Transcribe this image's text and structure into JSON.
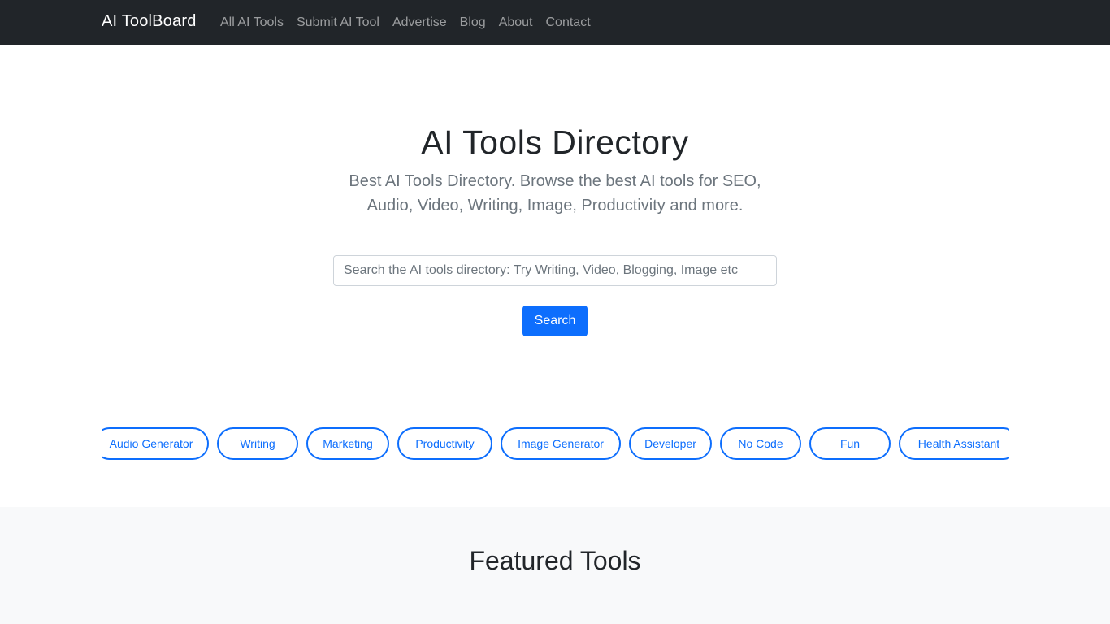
{
  "navbar": {
    "brand": "AI ToolBoard",
    "links": [
      "All AI Tools",
      "Submit AI Tool",
      "Advertise",
      "Blog",
      "About",
      "Contact"
    ]
  },
  "hero": {
    "title": "AI Tools Directory",
    "subtitle": "Best AI Tools Directory. Browse the best AI tools for SEO, Audio, Video, Writing, Image, Productivity and more.",
    "search_placeholder": "Search the AI tools directory: Try Writing, Video, Blogging, Image etc",
    "search_value": "",
    "search_button": "Search"
  },
  "categories": [
    {
      "label": "Audio Generator",
      "width": 142
    },
    {
      "label": "Writing",
      "width": 100
    },
    {
      "label": "Marketing",
      "width": 102
    },
    {
      "label": "Productivity",
      "width": 117
    },
    {
      "label": "Image Generator",
      "width": 148
    },
    {
      "label": "Developer",
      "width": 102
    },
    {
      "label": "No Code",
      "width": 100
    },
    {
      "label": "Fun",
      "width": 100
    },
    {
      "label": "Health Assistant",
      "width": 148
    }
  ],
  "featured": {
    "title": "Featured Tools"
  },
  "colors": {
    "navbar_bg": "#212529",
    "primary": "#0d6efd",
    "muted_text": "#6c757d",
    "section_bg": "#f8f9fa"
  }
}
